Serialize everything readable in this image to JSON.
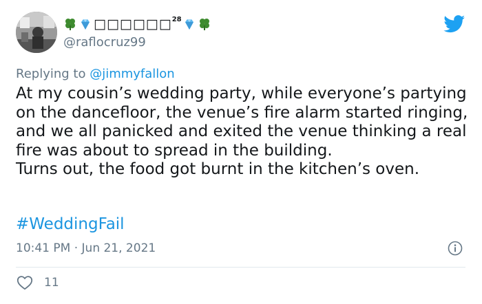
{
  "tweet": {
    "author": {
      "display_name_text": "□□□□□□",
      "display_name_sup": "28",
      "handle": "@raflocruz99",
      "name_emojis": [
        "four-leaf-clover",
        "gem",
        "gem",
        "four-leaf-clover"
      ]
    },
    "reply_prefix": "Replying to ",
    "reply_to": "@jimmyfallon",
    "body": "At my cousin’s wedding party, while everyone’s partying on the dancefloor, the venue’s fire alarm started ringing, and we all panicked and exited the venue thinking a real fire was about to spread in the building.\nTurns out, the food got burnt in the kitchen’s oven.",
    "hashtag": "#WeddingFail",
    "timestamp": "10:41 PM · Jun 21, 2021",
    "like_count": "11",
    "colors": {
      "link": "#1b95e0",
      "muted": "#657786",
      "text": "#14171a",
      "twitter_blue": "#1da1f2"
    },
    "icons": {
      "platform": "twitter-bird-icon",
      "info": "info-icon",
      "like": "heart-icon"
    }
  }
}
